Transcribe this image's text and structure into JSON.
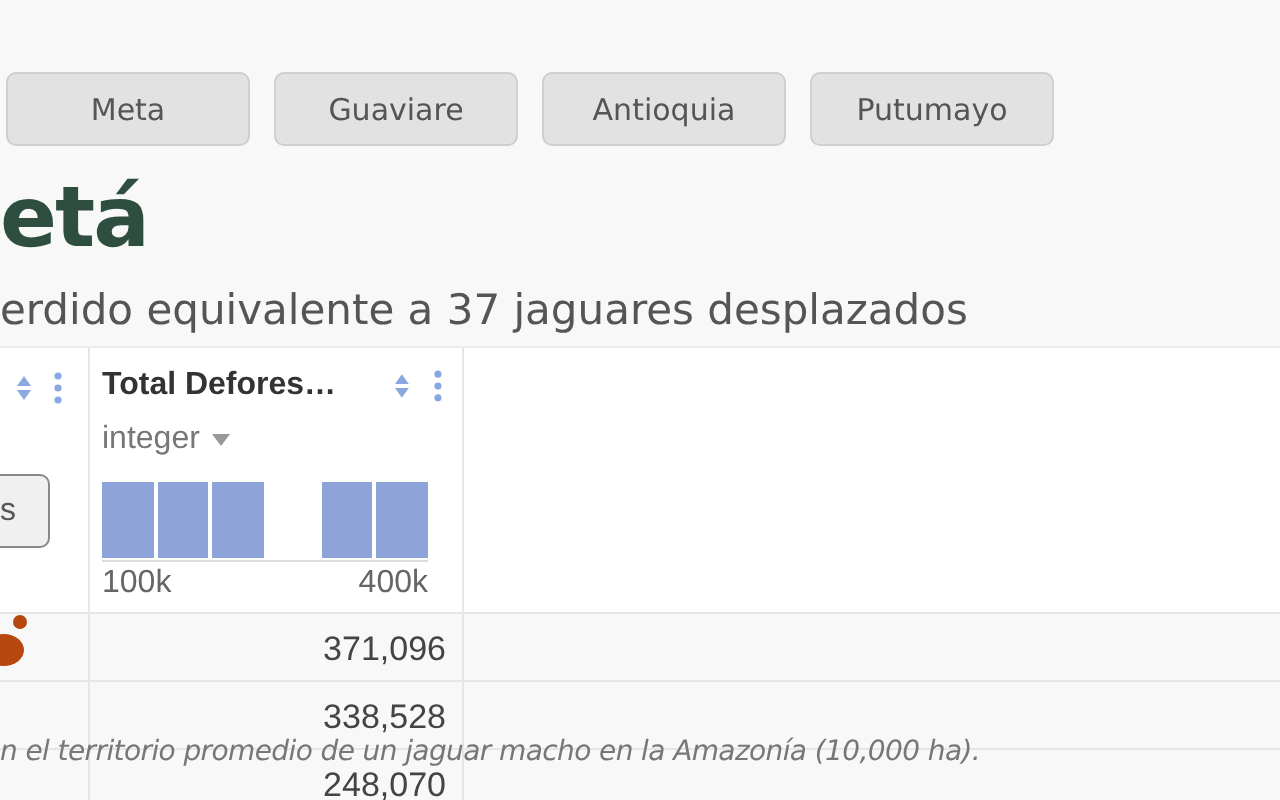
{
  "region_buttons": [
    "Meta",
    "Guaviare",
    "Antioquia",
    "Putumayo"
  ],
  "title": "etá",
  "subtitle": "erdido equivalente a 37 jaguares desplazados",
  "table": {
    "column_1": {
      "button": "s"
    },
    "columns": [
      {
        "name": "Total Defores…",
        "type": "integer",
        "hist_min": "100k",
        "hist_max": "400k"
      }
    ],
    "rows": [
      {
        "column_2": "371,096"
      },
      {
        "column_2": "338,528"
      },
      {
        "column_2": "248,070"
      }
    ]
  },
  "footnote": "n el territorio promedio de un jaguar macho en la Amazonía (10,000 ha)."
}
